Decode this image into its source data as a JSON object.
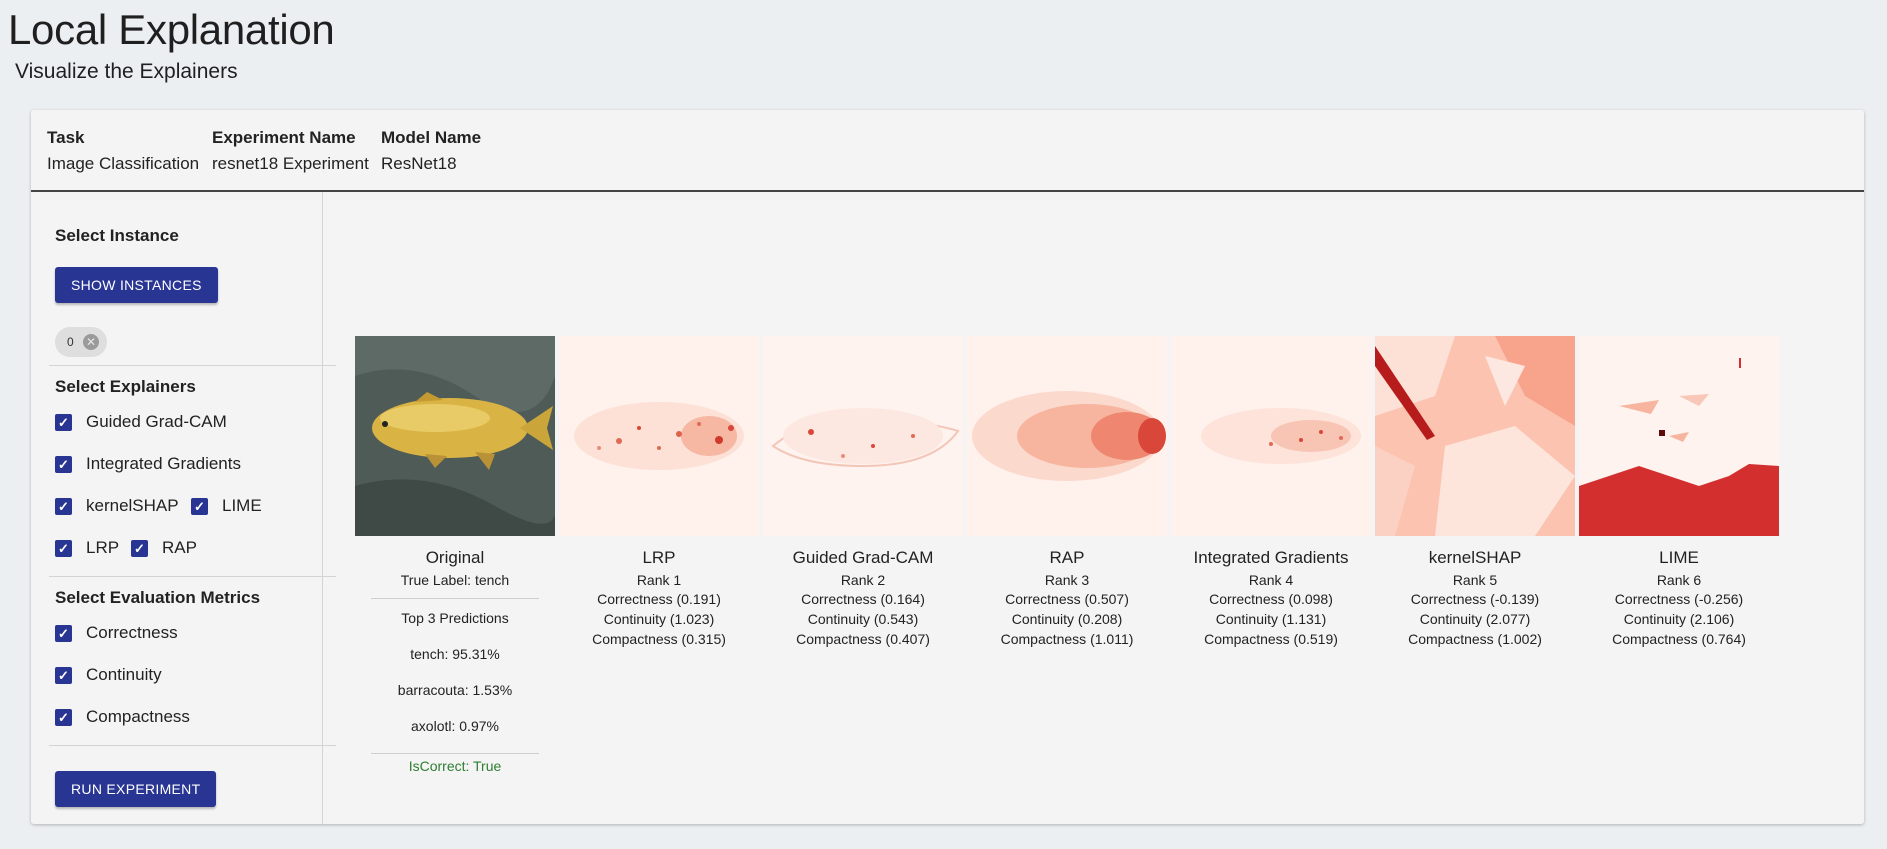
{
  "page": {
    "title": "Local Explanation",
    "subtitle": "Visualize the Explainers"
  },
  "meta": {
    "task_label": "Task",
    "task_value": "Image Classification",
    "experiment_label": "Experiment Name",
    "experiment_value": "resnet18 Experiment",
    "model_label": "Model Name",
    "model_value": "ResNet18"
  },
  "sidebar": {
    "select_instance": "Select Instance",
    "show_instances_button": "SHOW INSTANCES",
    "instance_chip": "0",
    "select_explainers": "Select Explainers",
    "explainers": [
      {
        "label": "Guided Grad-CAM",
        "checked": true
      },
      {
        "label": "Integrated Gradients",
        "checked": true
      },
      {
        "label": "kernelSHAP",
        "checked": true
      },
      {
        "label": "LIME",
        "checked": true
      },
      {
        "label": "LRP",
        "checked": true
      },
      {
        "label": "RAP",
        "checked": true
      }
    ],
    "select_metrics": "Select Evaluation Metrics",
    "metrics": [
      {
        "label": "Correctness",
        "checked": true
      },
      {
        "label": "Continuity",
        "checked": true
      },
      {
        "label": "Compactness",
        "checked": true
      }
    ],
    "run_button": "RUN EXPERIMENT"
  },
  "original": {
    "name": "Original",
    "true_label": "True Label: tench",
    "top3_title": "Top 3 Predictions",
    "predictions": [
      "tench: 95.31%",
      "barracouta: 1.53%",
      "axolotl: 0.97%"
    ],
    "is_correct": "IsCorrect: True"
  },
  "results": [
    {
      "name": "LRP",
      "rank": "Rank 1",
      "correctness": "Correctness (0.191)",
      "continuity": "Continuity (1.023)",
      "compactness": "Compactness (0.315)"
    },
    {
      "name": "Guided Grad-CAM",
      "rank": "Rank 2",
      "correctness": "Correctness (0.164)",
      "continuity": "Continuity (0.543)",
      "compactness": "Compactness (0.407)"
    },
    {
      "name": "RAP",
      "rank": "Rank 3",
      "correctness": "Correctness (0.507)",
      "continuity": "Continuity (0.208)",
      "compactness": "Compactness (1.011)"
    },
    {
      "name": "Integrated Gradients",
      "rank": "Rank 4",
      "correctness": "Correctness (0.098)",
      "continuity": "Continuity (1.131)",
      "compactness": "Compactness (0.519)"
    },
    {
      "name": "kernelSHAP",
      "rank": "Rank 5",
      "correctness": "Correctness (-0.139)",
      "continuity": "Continuity (2.077)",
      "compactness": "Compactness (1.002)"
    },
    {
      "name": "LIME",
      "rank": "Rank 6",
      "correctness": "Correctness (-0.256)",
      "continuity": "Continuity (2.106)",
      "compactness": "Compactness (0.764)"
    }
  ],
  "colors": {
    "primary": "#283593",
    "correct_text": "#2e7d32",
    "heatmap_base": "#fff1ec",
    "heatmap_hot": "#c62828"
  }
}
